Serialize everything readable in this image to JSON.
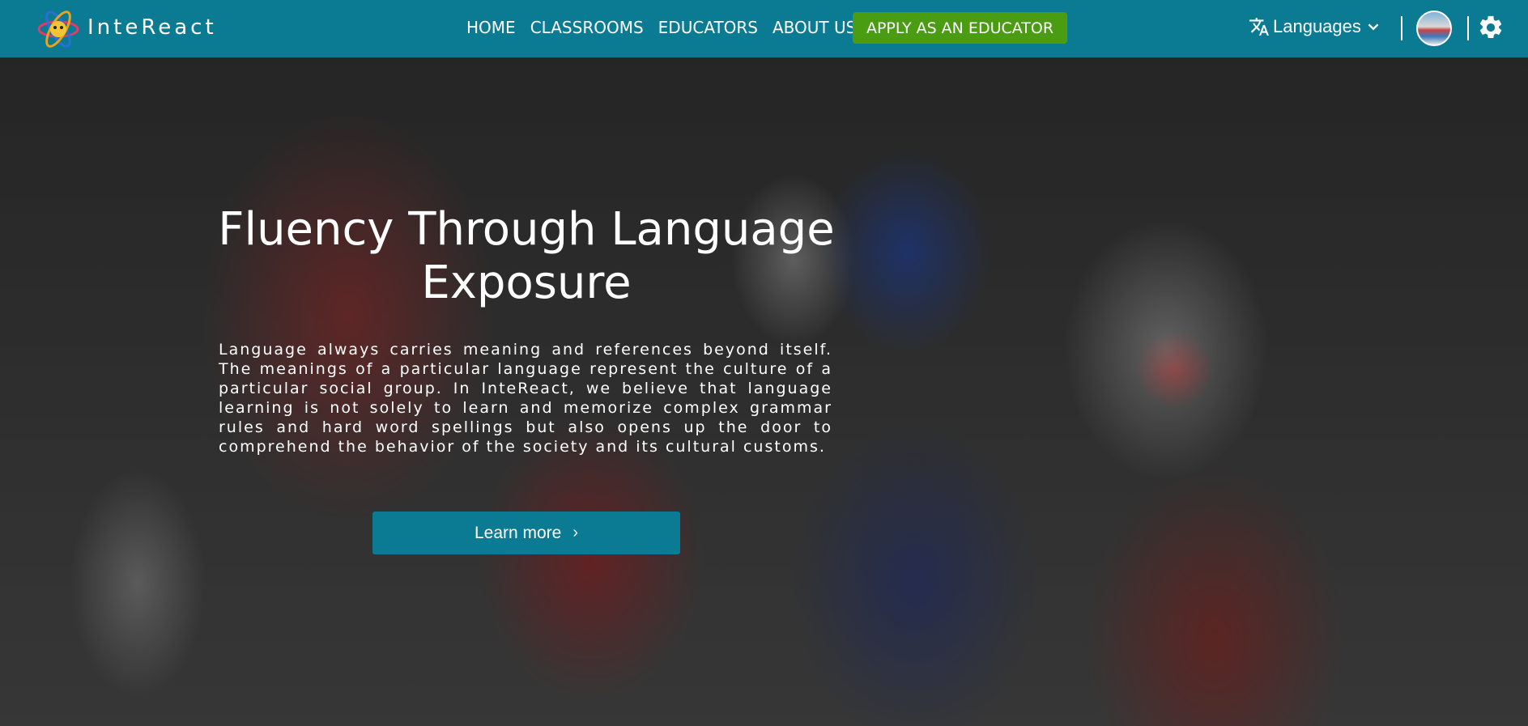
{
  "brand": {
    "name": "InteReact",
    "logo_icon": "atom-logo-icon"
  },
  "nav": {
    "links": [
      "HOME",
      "CLASSROOMS",
      "EDUCATORS",
      "ABOUT US"
    ],
    "apply_label": "APPLY AS AN EDUCATOR",
    "languages_label": "Languages",
    "language_icon": "translate-icon",
    "settings_icon": "gear-icon"
  },
  "hero": {
    "title": "Fluency Through Language Exposure",
    "body": "Language always carries meaning and references beyond itself. The meanings of a particular language represent the culture of a particular social group. In InteReact, we believe that language learning is not solely to learn and memorize complex grammar rules and hard word spellings but also opens up the door to comprehend the behavior of the society and its cultural customs.",
    "button_label": "Learn more"
  },
  "colors": {
    "navbar": "#0b7a93",
    "apply_button": "#4a9c12",
    "learn_button": "#0b7a93"
  }
}
